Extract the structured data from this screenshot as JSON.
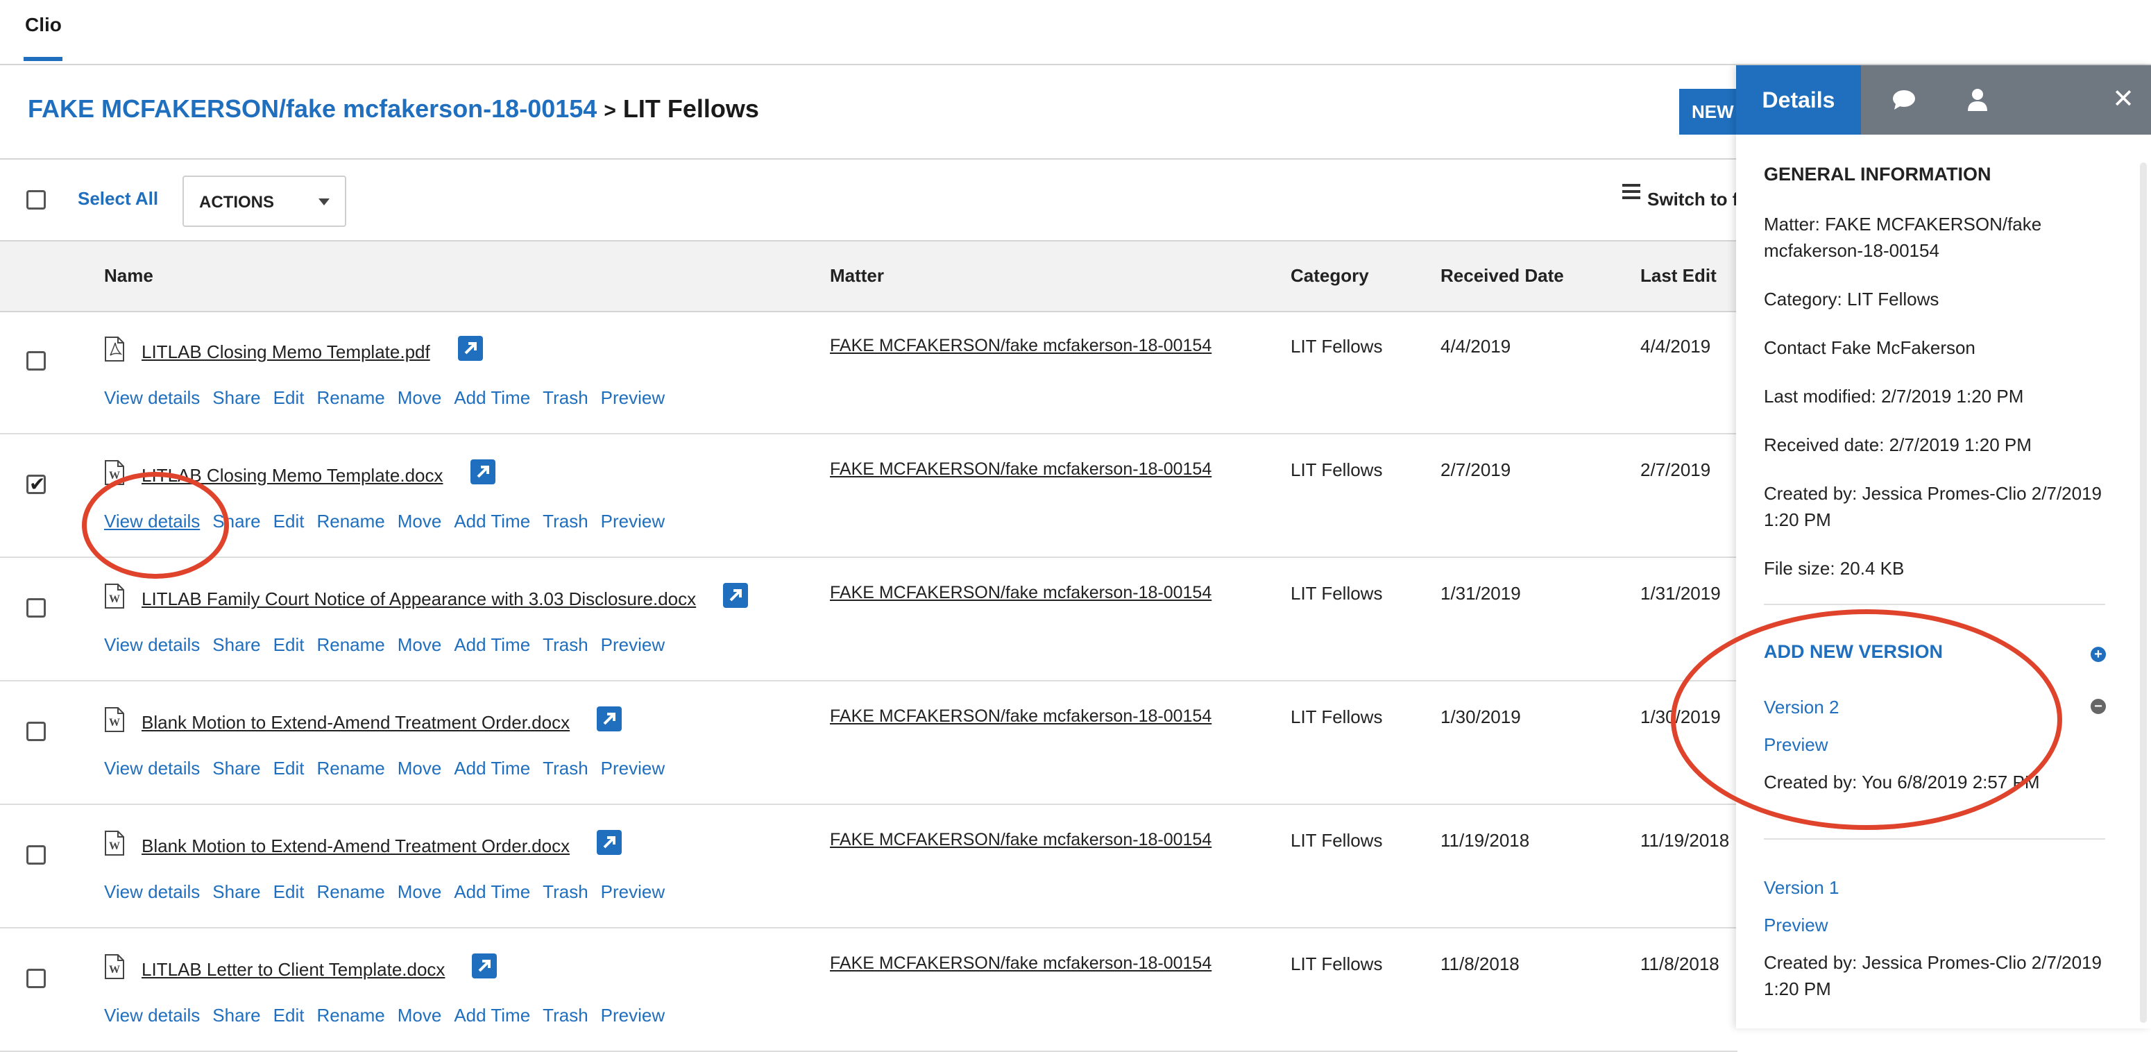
{
  "app": {
    "tab_label": "Clio"
  },
  "breadcrumb": {
    "matter_link": "FAKE MCFAKERSON/fake mcfakerson-18-00154",
    "separator": ">",
    "current": "LIT Fellows"
  },
  "header": {
    "new_button_label": "NEW"
  },
  "toolbar": {
    "select_all_label": "Select All",
    "actions_label": "ACTIONS",
    "switch_view_label": "Switch to f"
  },
  "columns": {
    "name": "Name",
    "matter": "Matter",
    "category": "Category",
    "received_date": "Received Date",
    "last_edit": "Last Edit"
  },
  "row_actions": [
    "View details",
    "Share",
    "Edit",
    "Rename",
    "Move",
    "Add Time",
    "Trash",
    "Preview"
  ],
  "documents": [
    {
      "name": "LITLAB Closing Memo Template.pdf",
      "file_type": "pdf",
      "checked": false,
      "matter": "FAKE MCFAKERSON/fake mcfakerson-18-00154",
      "category": "LIT Fellows",
      "received": "4/4/2019",
      "last_edit": "4/4/2019"
    },
    {
      "name": "LITLAB Closing Memo Template.docx",
      "file_type": "docx",
      "checked": true,
      "matter": "FAKE MCFAKERSON/fake mcfakerson-18-00154",
      "category": "LIT Fellows",
      "received": "2/7/2019",
      "last_edit": "2/7/2019"
    },
    {
      "name": "LITLAB Family Court Notice of Appearance with 3.03 Disclosure.docx",
      "file_type": "docx",
      "checked": false,
      "matter": "FAKE MCFAKERSON/fake mcfakerson-18-00154",
      "category": "LIT Fellows",
      "received": "1/31/2019",
      "last_edit": "1/31/2019"
    },
    {
      "name": "Blank Motion to Extend-Amend Treatment Order.docx",
      "file_type": "docx",
      "checked": false,
      "matter": "FAKE MCFAKERSON/fake mcfakerson-18-00154",
      "category": "LIT Fellows",
      "received": "1/30/2019",
      "last_edit": "1/30/2019"
    },
    {
      "name": "Blank Motion to Extend-Amend Treatment Order.docx",
      "file_type": "docx",
      "checked": false,
      "matter": "FAKE MCFAKERSON/fake mcfakerson-18-00154",
      "category": "LIT Fellows",
      "received": "11/19/2018",
      "last_edit": "11/19/2018"
    },
    {
      "name": "LITLAB Letter to Client Template.docx",
      "file_type": "docx",
      "checked": false,
      "matter": "FAKE MCFAKERSON/fake mcfakerson-18-00154",
      "category": "LIT Fellows",
      "received": "11/8/2018",
      "last_edit": "11/8/2018"
    }
  ],
  "details_panel": {
    "tab_details": "Details",
    "tab_icons": [
      "comment-icon",
      "person-icon"
    ],
    "close_icon": "close-icon",
    "general_heading": "GENERAL INFORMATION",
    "matter": "Matter: FAKE MCFAKERSON/fake mcfakerson-18-00154",
    "category": "Category: LIT Fellows",
    "contact": "Contact Fake McFakerson",
    "last_modified": "Last modified: 2/7/2019 1:20 PM",
    "received_date": "Received date: 2/7/2019 1:20 PM",
    "created_by": "Created by: Jessica Promes-Clio 2/7/2019 1:20 PM",
    "file_size": "File size: 20.4 KB",
    "add_new_version": "ADD NEW VERSION",
    "versions": [
      {
        "label": "Version 2",
        "preview": "Preview",
        "created": "Created by: You 6/8/2019 2:57 PM"
      },
      {
        "label": "Version 1",
        "preview": "Preview",
        "created": "Created by: Jessica Promes-Clio 2/7/2019 1:20 PM"
      }
    ]
  },
  "colors": {
    "accent": "#1f6fbe",
    "annotation": "#e0432c",
    "panel_tab_bar": "#6f7780"
  }
}
